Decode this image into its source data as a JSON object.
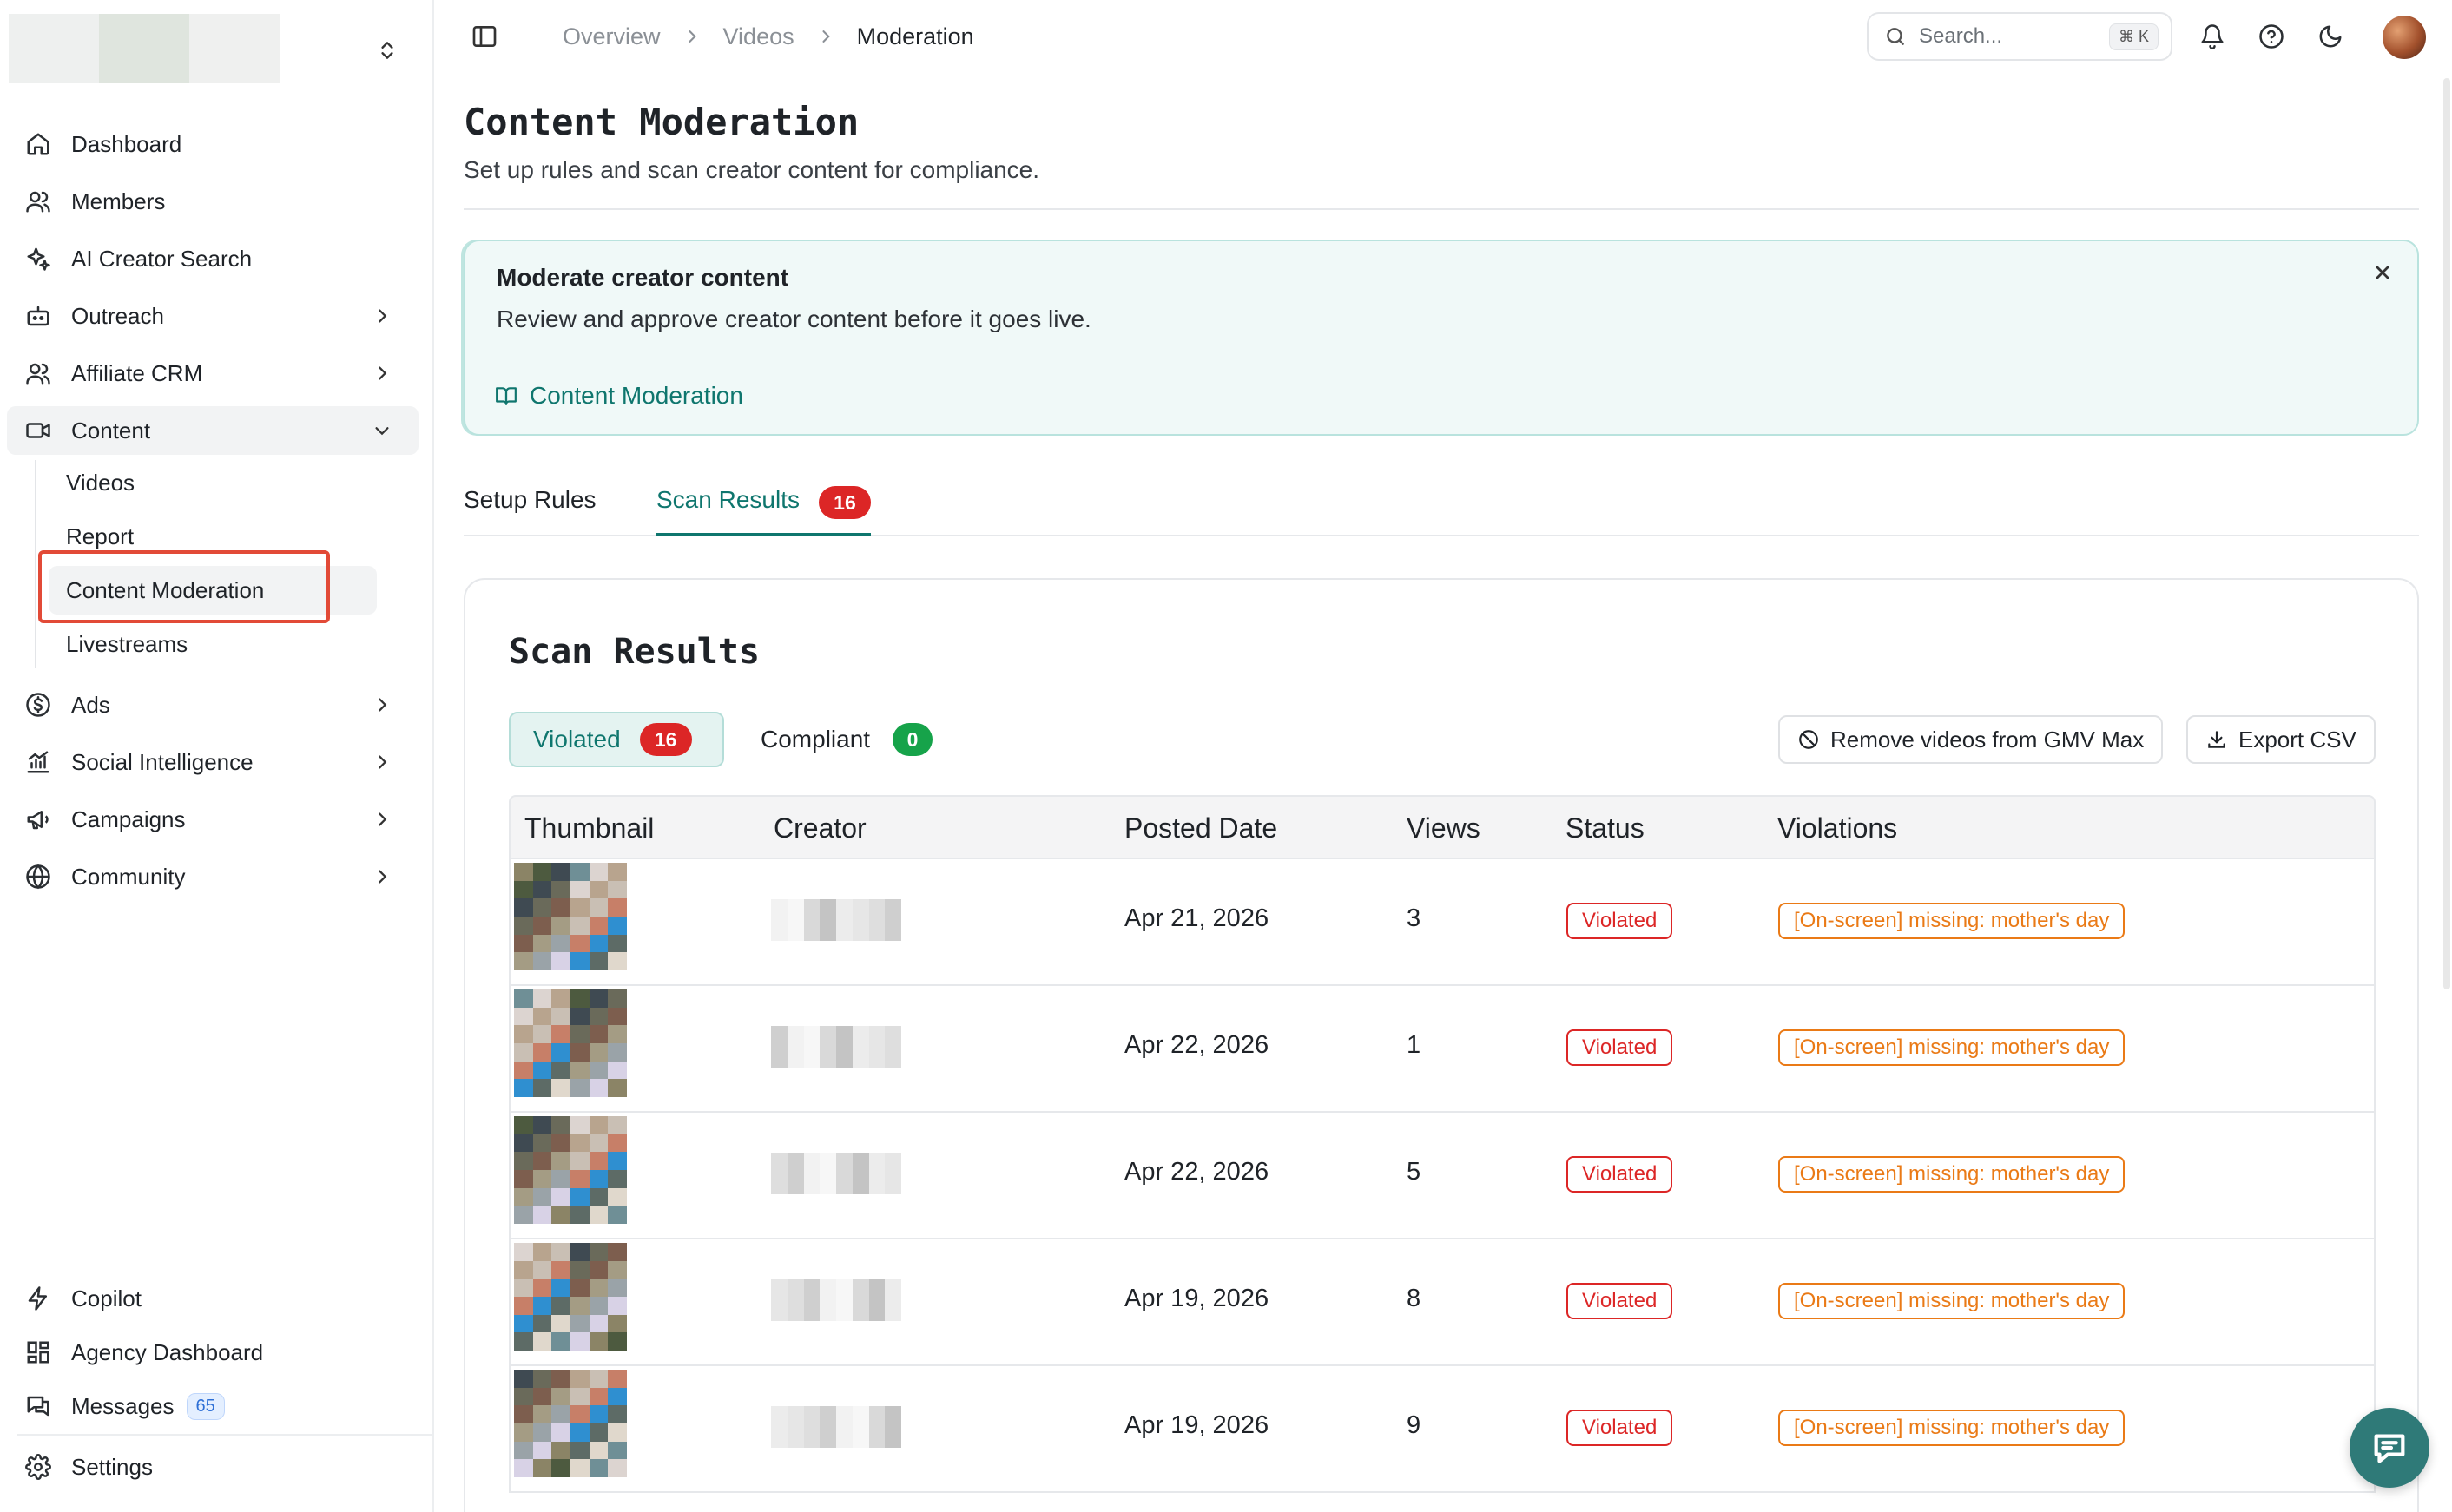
{
  "colors": {
    "accent": "#0f766e",
    "danger": "#dc2626",
    "warning": "#ea7a16",
    "success": "#16a34a",
    "highlight_box": "#e24a37"
  },
  "sidebar": {
    "main_items": [
      {
        "label": "Dashboard",
        "icon": "home-icon"
      },
      {
        "label": "Members",
        "icon": "users-icon"
      },
      {
        "label": "AI Creator Search",
        "icon": "sparkles-icon"
      },
      {
        "label": "Outreach",
        "icon": "bot-icon"
      },
      {
        "label": "Affiliate CRM",
        "icon": "users-icon"
      },
      {
        "label": "Content",
        "icon": "video-icon"
      }
    ],
    "content_sub": [
      "Videos",
      "Report",
      "Content Moderation",
      "Livestreams"
    ],
    "more_items": [
      {
        "label": "Ads",
        "icon": "dollar-icon"
      },
      {
        "label": "Social Intelligence",
        "icon": "chart-icon"
      },
      {
        "label": "Campaigns",
        "icon": "megaphone-icon"
      },
      {
        "label": "Community",
        "icon": "globe-icon"
      }
    ],
    "bottom_items": [
      {
        "label": "Copilot",
        "icon": "zap-icon"
      },
      {
        "label": "Agency Dashboard",
        "icon": "grid-icon"
      },
      {
        "label": "Messages",
        "icon": "messages-icon",
        "badge": "65"
      },
      {
        "label": "Settings",
        "icon": "gear-icon"
      }
    ]
  },
  "topbar": {
    "breadcrumbs": [
      "Overview",
      "Videos",
      "Moderation"
    ],
    "search_placeholder": "Search...",
    "search_shortcut": "⌘ K"
  },
  "page": {
    "title": "Content Moderation",
    "subtitle": "Set up rules and scan creator content for compliance."
  },
  "info_card": {
    "title": "Moderate creator content",
    "description": "Review and approve creator content before it goes live.",
    "link": "Content Moderation"
  },
  "tabs": [
    {
      "label": "Setup Rules"
    },
    {
      "label": "Scan Results",
      "count": "16"
    }
  ],
  "results": {
    "title": "Scan Results",
    "filters": [
      {
        "label": "Violated",
        "count": "16"
      },
      {
        "label": "Compliant",
        "count": "0"
      }
    ],
    "actions": {
      "remove_gmv": "Remove videos from GMV Max",
      "export": "Export CSV"
    },
    "columns": [
      "Thumbnail",
      "Creator",
      "Posted Date",
      "Views",
      "Status",
      "Violations"
    ],
    "rows": [
      {
        "date": "Apr 21, 2026",
        "views": "3",
        "status": "Violated",
        "violation": "[On-screen] missing: mother's day"
      },
      {
        "date": "Apr 22, 2026",
        "views": "1",
        "status": "Violated",
        "violation": "[On-screen] missing: mother's day"
      },
      {
        "date": "Apr 22, 2026",
        "views": "5",
        "status": "Violated",
        "violation": "[On-screen] missing: mother's day"
      },
      {
        "date": "Apr 19, 2026",
        "views": "8",
        "status": "Violated",
        "violation": "[On-screen] missing: mother's day"
      },
      {
        "date": "Apr 19, 2026",
        "views": "9",
        "status": "Violated",
        "violation": "[On-screen] missing: mother's day"
      }
    ]
  }
}
